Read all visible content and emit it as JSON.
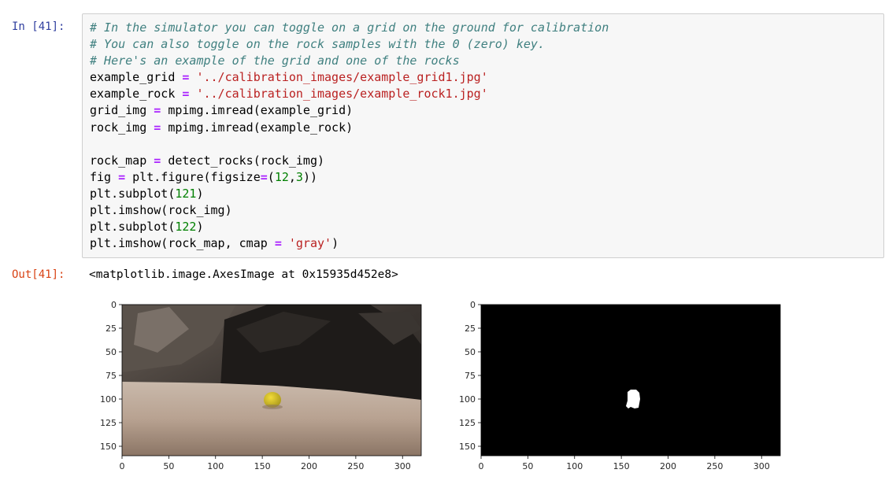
{
  "cell": {
    "in_prompt": "In [41]:",
    "out_prompt": "Out[41]:",
    "output_text": "<matplotlib.image.AxesImage at 0x15935d452e8>",
    "code_lines": [
      [
        {
          "t": "# In the simulator you can toggle on a grid on the ground for calibration",
          "k": "c"
        }
      ],
      [
        {
          "t": "# You can also toggle on the rock samples with the 0 (zero) key.",
          "k": "c"
        }
      ],
      [
        {
          "t": "# Here's an example of the grid and one of the rocks",
          "k": "c"
        }
      ],
      [
        {
          "t": "example_grid ",
          "k": ""
        },
        {
          "t": "=",
          "k": "o"
        },
        {
          "t": " ",
          "k": ""
        },
        {
          "t": "'../calibration_images/example_grid1.jpg'",
          "k": "s"
        }
      ],
      [
        {
          "t": "example_rock ",
          "k": ""
        },
        {
          "t": "=",
          "k": "o"
        },
        {
          "t": " ",
          "k": ""
        },
        {
          "t": "'../calibration_images/example_rock1.jpg'",
          "k": "s"
        }
      ],
      [
        {
          "t": "grid_img ",
          "k": ""
        },
        {
          "t": "=",
          "k": "o"
        },
        {
          "t": " mpimg.imread(example_grid)",
          "k": ""
        }
      ],
      [
        {
          "t": "rock_img ",
          "k": ""
        },
        {
          "t": "=",
          "k": "o"
        },
        {
          "t": " mpimg.imread(example_rock)",
          "k": ""
        }
      ],
      [
        {
          "t": "",
          "k": ""
        }
      ],
      [
        {
          "t": "rock_map ",
          "k": ""
        },
        {
          "t": "=",
          "k": "o"
        },
        {
          "t": " detect_rocks(rock_img)",
          "k": ""
        }
      ],
      [
        {
          "t": "fig ",
          "k": ""
        },
        {
          "t": "=",
          "k": "o"
        },
        {
          "t": " plt.figure(figsize",
          "k": ""
        },
        {
          "t": "=",
          "k": "o"
        },
        {
          "t": "(",
          "k": ""
        },
        {
          "t": "12",
          "k": "n"
        },
        {
          "t": ",",
          "k": ""
        },
        {
          "t": "3",
          "k": "n"
        },
        {
          "t": "))",
          "k": ""
        }
      ],
      [
        {
          "t": "plt.subplot(",
          "k": ""
        },
        {
          "t": "121",
          "k": "n"
        },
        {
          "t": ")",
          "k": ""
        }
      ],
      [
        {
          "t": "plt.imshow(rock_img)",
          "k": ""
        }
      ],
      [
        {
          "t": "plt.subplot(",
          "k": ""
        },
        {
          "t": "122",
          "k": "n"
        },
        {
          "t": ")",
          "k": ""
        }
      ],
      [
        {
          "t": "plt.imshow(rock_map, cmap ",
          "k": ""
        },
        {
          "t": "=",
          "k": "o"
        },
        {
          "t": " ",
          "k": ""
        },
        {
          "t": "'gray'",
          "k": "s"
        },
        {
          "t": ")",
          "k": ""
        }
      ]
    ]
  },
  "plots": {
    "left": {
      "y_ticks": [
        "0",
        "25",
        "50",
        "75",
        "100",
        "125",
        "150"
      ],
      "x_ticks": [
        "0",
        "50",
        "100",
        "150",
        "200",
        "250",
        "300"
      ]
    },
    "right": {
      "y_ticks": [
        "0",
        "25",
        "50",
        "75",
        "100",
        "125",
        "150"
      ],
      "x_ticks": [
        "0",
        "50",
        "100",
        "150",
        "200",
        "250",
        "300"
      ]
    }
  },
  "colors": {
    "in_prompt": "#303f9f",
    "out_prompt": "#d84315",
    "comment": "#408080",
    "string": "#ba2121",
    "number": "#008000",
    "operator": "#aa22ff"
  }
}
